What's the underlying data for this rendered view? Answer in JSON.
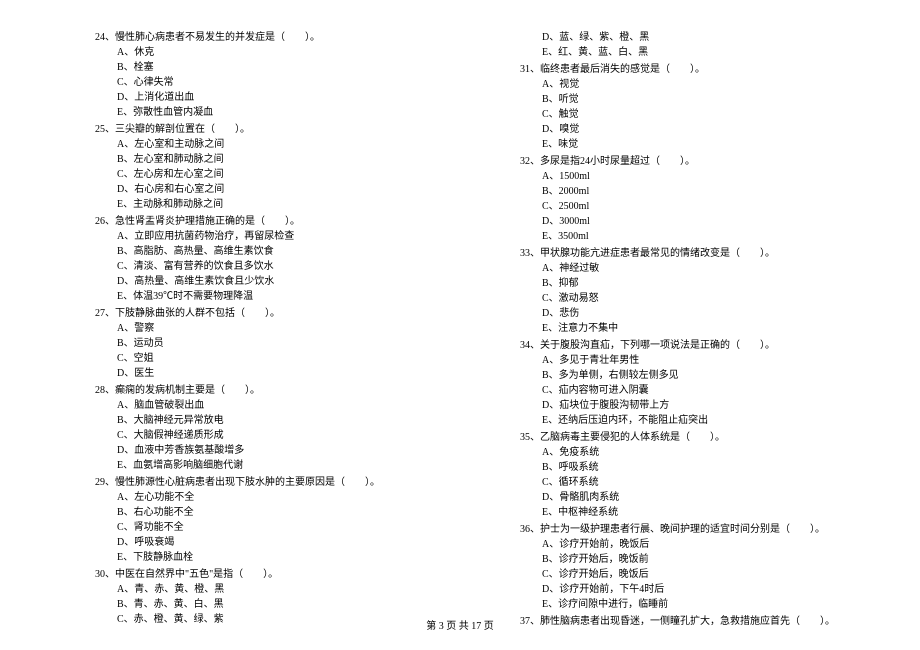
{
  "left": [
    {
      "q": "24、慢性肺心病患者不易发生的并发症是（　　）。",
      "opts": [
        "A、休克",
        "B、栓塞",
        "C、心律失常",
        "D、上消化道出血",
        "E、弥散性血管内凝血"
      ]
    },
    {
      "q": "25、三尖瓣的解剖位置在（　　）。",
      "opts": [
        "A、左心室和主动脉之间",
        "B、左心室和肺动脉之间",
        "C、左心房和左心室之间",
        "D、右心房和右心室之间",
        "E、主动脉和肺动脉之间"
      ]
    },
    {
      "q": "26、急性肾盂肾炎护理措施正确的是（　　）。",
      "opts": [
        "A、立即应用抗菌药物治疗，再留尿检查",
        "B、高脂肪、高热量、高维生素饮食",
        "C、清淡、富有营养的饮食且多饮水",
        "D、高热量、高维生素饮食且少饮水",
        "E、体温39℃时不需要物理降温"
      ]
    },
    {
      "q": "27、下肢静脉曲张的人群不包括（　　）。",
      "opts": [
        "A、警察",
        "B、运动员",
        "C、空姐",
        "D、医生"
      ]
    },
    {
      "q": "28、癫痫的发病机制主要是（　　）。",
      "opts": [
        "A、脑血管破裂出血",
        "B、大脑神经元异常放电",
        "C、大脑假神经递质形成",
        "D、血液中芳香族氨基酸增多",
        "E、血氨增高影响脑细胞代谢"
      ]
    },
    {
      "q": "29、慢性肺源性心脏病患者出现下肢水肿的主要原因是（　　）。",
      "opts": [
        "A、左心功能不全",
        "B、右心功能不全",
        "C、肾功能不全",
        "D、呼吸衰竭",
        "E、下肢静脉血栓"
      ]
    },
    {
      "q": "30、中医在自然界中\"五色\"是指（　　）。",
      "opts": [
        "A、青、赤、黄、橙、黑",
        "B、青、赤、黄、白、黑",
        "C、赤、橙、黄、绿、紫"
      ]
    }
  ],
  "right_prefix_opts": [
    "D、蓝、绿、紫、橙、黑",
    "E、红、黄、蓝、白、黑"
  ],
  "right": [
    {
      "q": "31、临终患者最后消失的感觉是（　　）。",
      "opts": [
        "A、视觉",
        "B、听觉",
        "C、触觉",
        "D、嗅觉",
        "E、味觉"
      ]
    },
    {
      "q": "32、多尿是指24小时尿量超过（　　）。",
      "opts": [
        "A、1500ml",
        "B、2000ml",
        "C、2500ml",
        "D、3000ml",
        "E、3500ml"
      ]
    },
    {
      "q": "33、甲状腺功能亢进症患者最常见的情绪改变是（　　）。",
      "opts": [
        "A、神经过敏",
        "B、抑郁",
        "C、激动易怒",
        "D、悲伤",
        "E、注意力不集中"
      ]
    },
    {
      "q": "34、关于腹股沟直疝，下列哪一项说法是正确的（　　）。",
      "opts": [
        "A、多见于青壮年男性",
        "B、多为单侧，右侧较左侧多见",
        "C、疝内容物可进入阴囊",
        "D、疝块位于腹股沟韧带上方",
        "E、还纳后压迫内环，不能阻止疝突出"
      ]
    },
    {
      "q": "35、乙脑病毒主要侵犯的人体系统是（　　）。",
      "opts": [
        "A、免疫系统",
        "B、呼吸系统",
        "C、循环系统",
        "D、骨骼肌肉系统",
        "E、中枢神经系统"
      ]
    },
    {
      "q": "36、护士为一级护理患者行晨、晚间护理的适宜时间分别是（　　）。",
      "opts": [
        "A、诊疗开始前，晚饭后",
        "B、诊疗开始后，晚饭前",
        "C、诊疗开始后，晚饭后",
        "D、诊疗开始前，下午4时后",
        "E、诊疗间隙中进行，临睡前"
      ]
    },
    {
      "q": "37、肺性脑病患者出现昏迷，一侧瞳孔扩大，急救措施应首先（　　）。",
      "opts": []
    }
  ],
  "footer": "第 3 页 共 17 页"
}
